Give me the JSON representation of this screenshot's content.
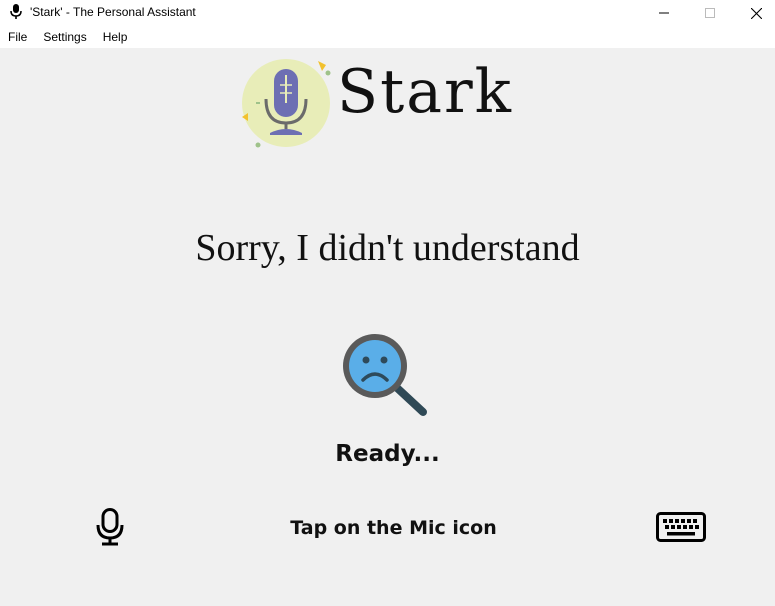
{
  "window": {
    "title": "'Stark' - The Personal Assistant",
    "controls": {
      "minimize": "minimize-icon",
      "maximize": "maximize-icon",
      "close": "close-icon"
    }
  },
  "menubar": {
    "items": [
      {
        "label": "File"
      },
      {
        "label": "Settings"
      },
      {
        "label": "Help"
      }
    ]
  },
  "header": {
    "app_name": "Stark",
    "logo_icon": "microphone-logo-icon"
  },
  "main": {
    "response": "Sorry, I didn't understand",
    "status_icon": "sad-magnifier-icon",
    "status": "Ready...",
    "hint": "Tap on the Mic icon"
  },
  "controls": {
    "mic_icon": "microphone-icon",
    "keyboard_icon": "keyboard-icon"
  },
  "colors": {
    "background": "#f0f0f0",
    "titlebar": "#ffffff",
    "logo_circle": "#e8edb8",
    "mic_body": "#6d6fb3",
    "face": "#5aaee8",
    "lens_ring": "#5a5a5a",
    "text": "#111111"
  }
}
